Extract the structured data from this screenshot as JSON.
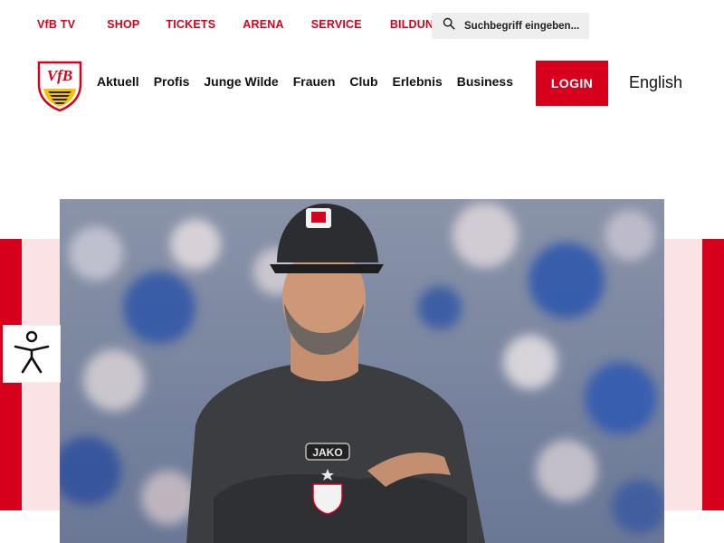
{
  "topnav": {
    "links": [
      "VfB TV",
      "SHOP",
      "TICKETS",
      "ARENA",
      "SERVICE",
      "BILDUNG"
    ]
  },
  "search": {
    "placeholder": "Suchbegriff eingeben...",
    "icon": "search-icon"
  },
  "logo": {
    "text": "VfB",
    "icon": "vfb-crest-icon"
  },
  "mainnav": {
    "items": [
      "Aktuell",
      "Profis",
      "Junge Wilde",
      "Frauen",
      "Club",
      "Erlebnis",
      "Business"
    ]
  },
  "header": {
    "login_label": "LOGIN",
    "language_label": "English"
  },
  "hero": {
    "image": "coach-portrait-photo",
    "shirt_brand": "JAKO"
  },
  "accessibility": {
    "icon": "accessibility-icon"
  },
  "colors": {
    "brand_red": "#d6001c",
    "pale_pink": "#fbe3e5",
    "text_dark": "#111111"
  }
}
